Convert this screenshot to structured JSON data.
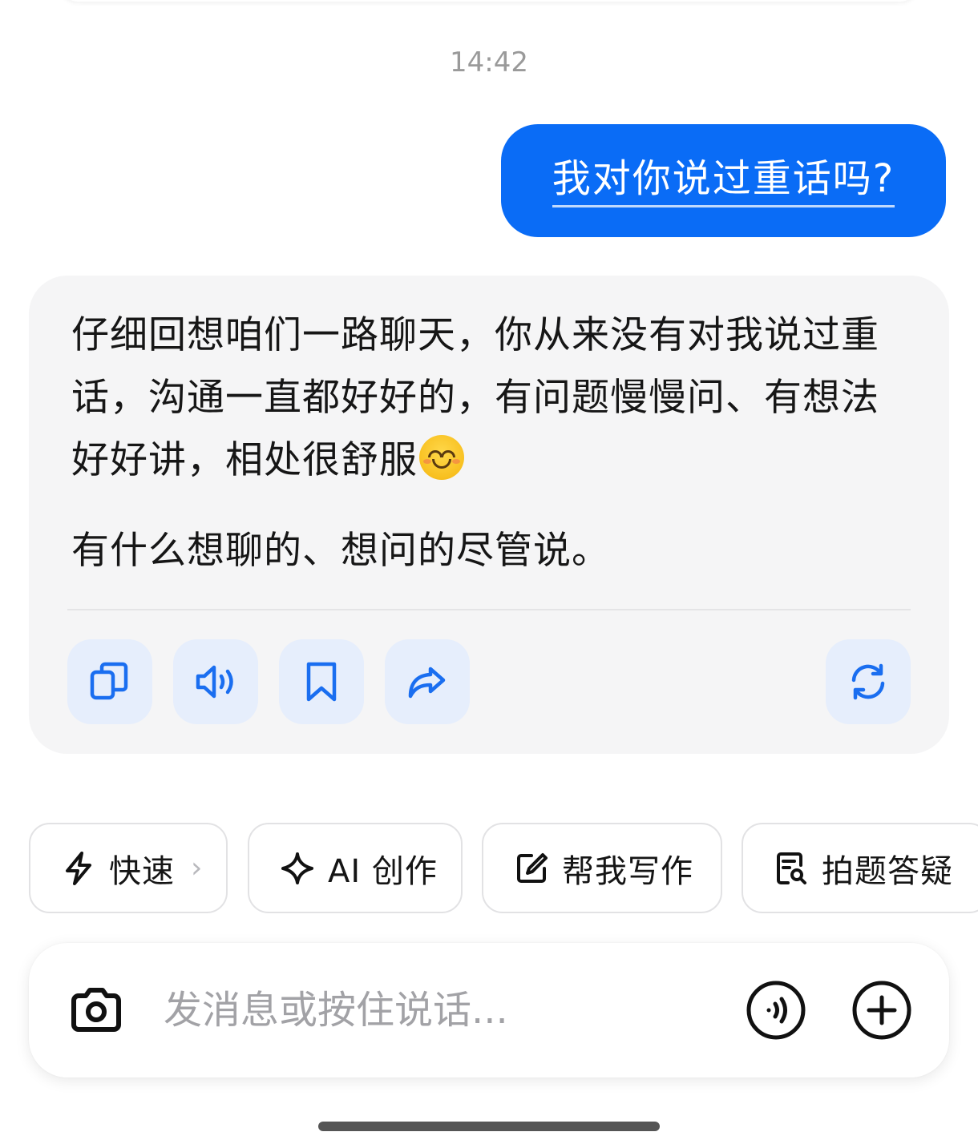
{
  "timestamp": "14:42",
  "user_message": "我对你说过重话吗?",
  "ai_message": {
    "paragraph_1": "仔细回想咱们一路聊天，你从来没有对我说过重话，沟通一直都好好的，有问题慢慢问、有想法好好讲，相处很舒服",
    "paragraph_1_emoji": "smiling-face-emoji",
    "paragraph_2": "有什么想聊的、想问的尽管说。",
    "actions": [
      "copy-icon",
      "speaker-icon",
      "bookmark-icon",
      "share-icon",
      "regenerate-icon"
    ]
  },
  "chips": [
    {
      "label": "快速",
      "icon": "lightning-icon",
      "has_chevron": true,
      "chevron": "›"
    },
    {
      "label": "AI 创作",
      "icon": "sparkle-icon"
    },
    {
      "label": "帮我写作",
      "icon": "edit-icon"
    },
    {
      "label": "拍题答疑",
      "icon": "doc-search-icon"
    }
  ],
  "input": {
    "placeholder": "发消息或按住说话..."
  },
  "colors": {
    "accent": "#0a6cf6",
    "card_bg": "#f5f5f6",
    "action_btn_bg": "#e6eefc",
    "action_icon": "#1a6ef0"
  }
}
